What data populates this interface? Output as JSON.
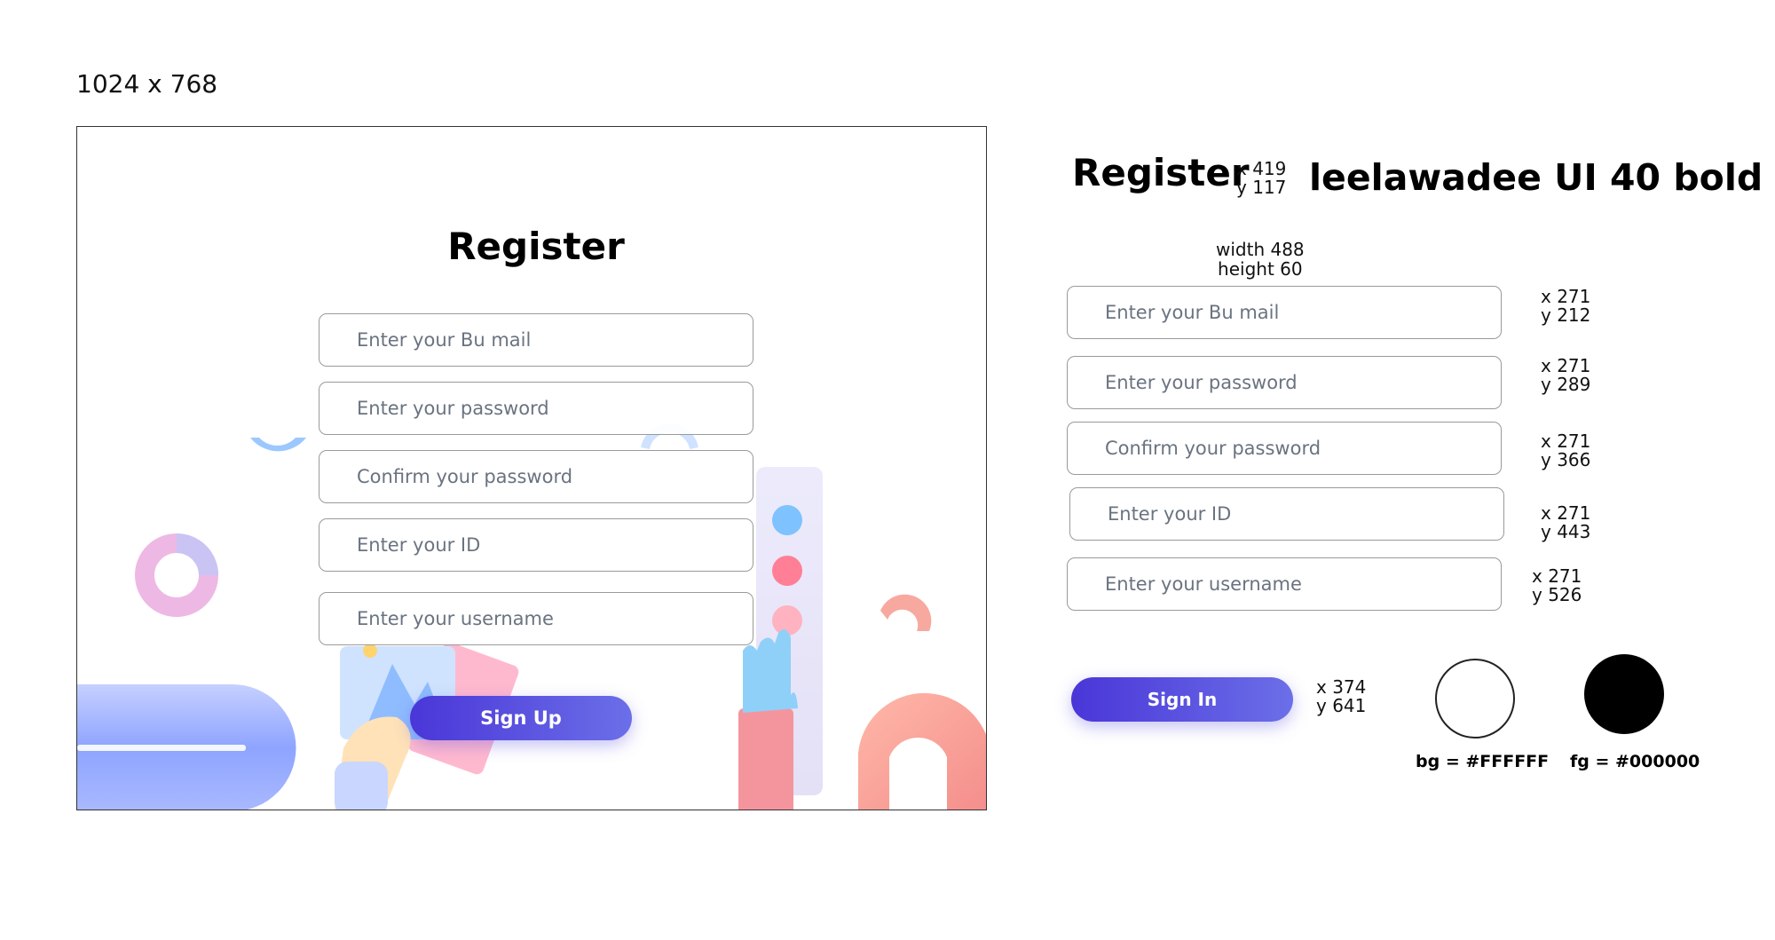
{
  "canvas_label": "1024 x 768",
  "mockup": {
    "title": "Register",
    "fields": [
      {
        "placeholder": "Enter your Bu mail"
      },
      {
        "placeholder": "Enter your password"
      },
      {
        "placeholder": "Confirm your password"
      },
      {
        "placeholder": "Enter your ID"
      },
      {
        "placeholder": "Enter your username"
      }
    ],
    "button_label": "Sign Up"
  },
  "spec": {
    "title": "Register",
    "title_coords": [
      "x 419",
      "y 117"
    ],
    "font_note": "leelawadee UI 40 bold",
    "field_size": [
      "width 488",
      "height 60"
    ],
    "fields": [
      {
        "placeholder": "Enter your Bu mail",
        "coords": [
          "x 271",
          "y 212"
        ]
      },
      {
        "placeholder": "Enter your password",
        "coords": [
          "x 271",
          "y 289"
        ]
      },
      {
        "placeholder": "Confirm your password",
        "coords": [
          "x 271",
          "y 366"
        ]
      },
      {
        "placeholder": "Enter your ID",
        "coords": [
          "x 271",
          "y 443"
        ]
      },
      {
        "placeholder": "Enter your username",
        "coords": [
          "x 271",
          "y 526"
        ]
      }
    ],
    "button_label": "Sign In",
    "button_coords": [
      "x 374",
      "y 641"
    ],
    "bg_label": "bg = #FFFFFF",
    "fg_label": "fg = #000000"
  },
  "colors": {
    "bg": "#FFFFFF",
    "fg": "#000000",
    "accent_start": "#4a36d8",
    "accent_end": "#6b6fe8"
  }
}
